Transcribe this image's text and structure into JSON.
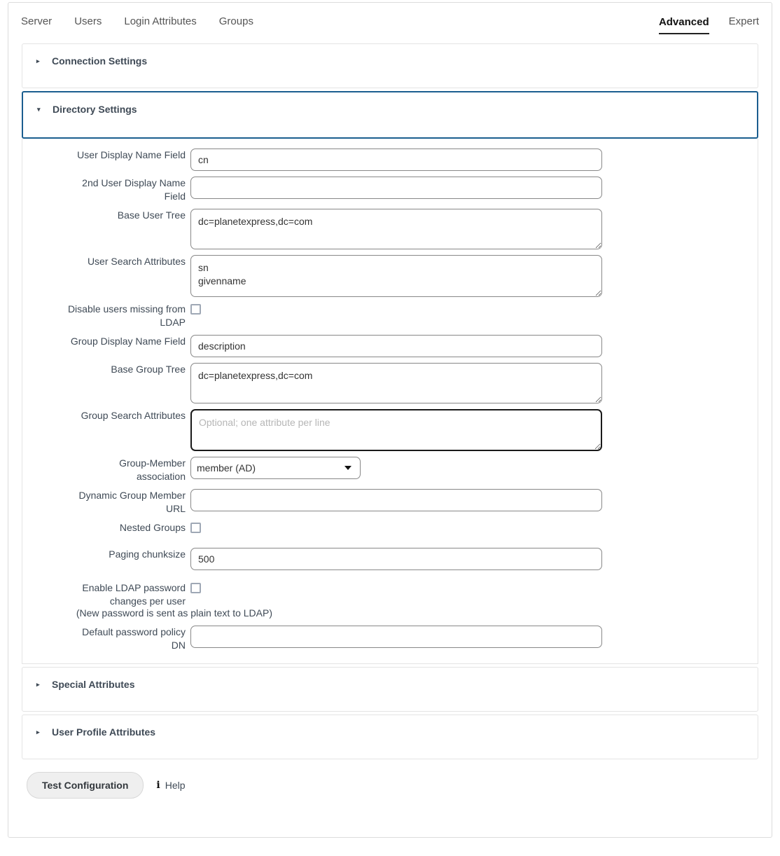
{
  "tabs": {
    "left": [
      {
        "label": "Server",
        "active": false
      },
      {
        "label": "Users",
        "active": false
      },
      {
        "label": "Login Attributes",
        "active": false
      },
      {
        "label": "Groups",
        "active": false
      }
    ],
    "right": [
      {
        "label": "Advanced",
        "active": true
      },
      {
        "label": "Expert",
        "active": false
      }
    ]
  },
  "panels": {
    "connection_settings": {
      "title": "Connection Settings",
      "caret": "▸",
      "expanded": false
    },
    "directory_settings": {
      "title": "Directory Settings",
      "caret": "▾",
      "expanded": true
    },
    "special_attributes": {
      "title": "Special Attributes",
      "caret": "▸",
      "expanded": false
    },
    "user_profile_attributes": {
      "title": "User Profile Attributes",
      "caret": "▸",
      "expanded": false
    }
  },
  "fields": {
    "user_display_name": {
      "label": "User Display Name Field",
      "value": "cn",
      "placeholder": ""
    },
    "second_user_display_name": {
      "label_line1": "2nd User Display Name",
      "label_line2": "Field",
      "value": "",
      "placeholder": ""
    },
    "base_user_tree": {
      "label": "Base User Tree",
      "value": "dc=planetexpress,dc=com",
      "placeholder": ""
    },
    "user_search_attributes": {
      "label": "User Search Attributes",
      "value": "sn\ngivenname",
      "placeholder": ""
    },
    "disable_users_missing": {
      "label_line1": "Disable users missing from",
      "label_line2": "LDAP",
      "checked": false
    },
    "group_display_name": {
      "label": "Group Display Name Field",
      "value": "description",
      "placeholder": ""
    },
    "base_group_tree": {
      "label": "Base Group Tree",
      "value": "dc=planetexpress,dc=com",
      "placeholder": ""
    },
    "group_search_attributes": {
      "label": "Group Search Attributes",
      "value": "",
      "placeholder": "Optional; one attribute per line",
      "focused": true
    },
    "group_member_association": {
      "label_line1": "Group-Member",
      "label_line2": "association",
      "selected": "member (AD)",
      "options": [
        "member (AD)"
      ]
    },
    "dynamic_group_member_url": {
      "label_line1": "Dynamic Group Member",
      "label_line2": "URL",
      "value": "",
      "placeholder": ""
    },
    "nested_groups": {
      "label": "Nested Groups",
      "checked": false
    },
    "paging_chunksize": {
      "label": "Paging chunksize",
      "value": "500",
      "placeholder": ""
    },
    "enable_ldap_password_changes": {
      "label_line1": "Enable LDAP password",
      "label_line2": "changes per user",
      "note": "(New password is sent as plain text to LDAP)",
      "checked": false
    },
    "default_password_policy_dn": {
      "label_line1": "Default password policy",
      "label_line2": "DN",
      "value": "",
      "placeholder": ""
    }
  },
  "footer": {
    "test_button": "Test Configuration",
    "help_label": "Help",
    "help_icon": "info-icon"
  },
  "colors": {
    "accent_border": "#1b5e8f",
    "panel_border": "#e4e4e4",
    "input_border": "#888888",
    "label_text": "#3f4a56",
    "active_tab_underline": "#222222"
  }
}
